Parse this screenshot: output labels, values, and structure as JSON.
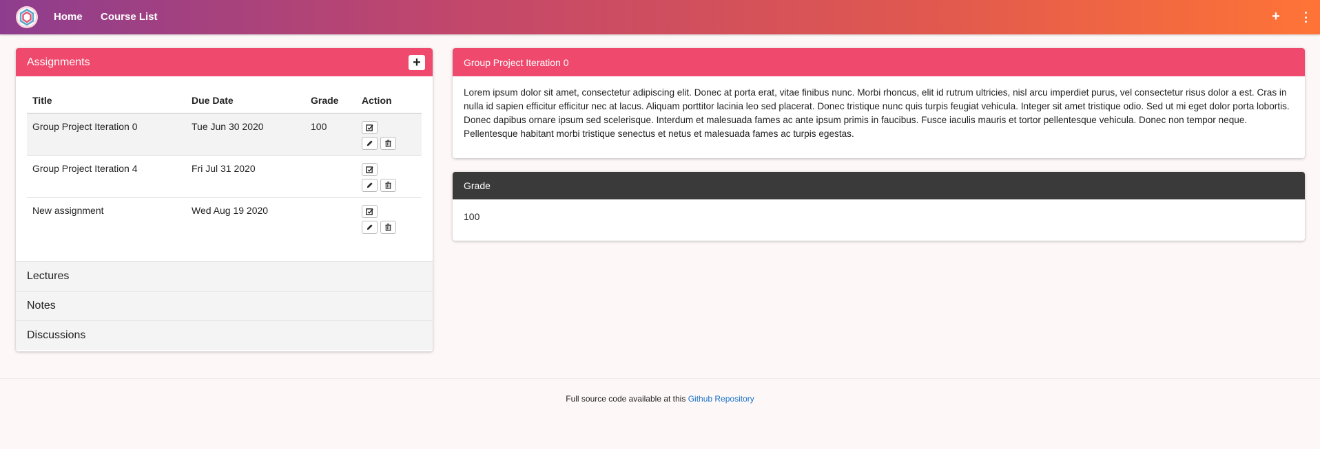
{
  "nav": {
    "home": "Home",
    "course_list": "Course List",
    "plus_icon": "plus-icon",
    "menu_icon": "kebab-menu-icon"
  },
  "assignments": {
    "title": "Assignments",
    "columns": [
      "Title",
      "Due Date",
      "Grade",
      "Action"
    ],
    "rows": [
      {
        "title": "Group Project Iteration 0",
        "due": "Tue Jun 30 2020",
        "grade": "100"
      },
      {
        "title": "Group Project Iteration 4",
        "due": "Fri Jul 31 2020",
        "grade": ""
      },
      {
        "title": "New assignment",
        "due": "Wed Aug 19 2020",
        "grade": ""
      }
    ]
  },
  "sections": [
    "Lectures",
    "Notes",
    "Discussions"
  ],
  "detail": {
    "title": "Group Project Iteration 0",
    "body": "Lorem ipsum dolor sit amet, consectetur adipiscing elit. Donec at porta erat, vitae finibus nunc. Morbi rhoncus, elit id rutrum ultricies, nisl arcu imperdiet purus, vel consectetur risus dolor a est. Cras in nulla id sapien efficitur efficitur nec at lacus. Aliquam porttitor lacinia leo sed placerat. Donec tristique nunc quis turpis feugiat vehicula. Integer sit amet tristique odio. Sed ut mi eget dolor porta lobortis. Donec dapibus ornare ipsum sed scelerisque. Interdum et malesuada fames ac ante ipsum primis in faucibus. Fusce iaculis mauris et tortor pellentesque vehicula. Donec non tempor neque. Pellentesque habitant morbi tristique senectus et netus et malesuada fames ac turpis egestas."
  },
  "grade": {
    "title": "Grade",
    "value": "100"
  },
  "footer": {
    "text": "Full source code available at this ",
    "link": "Github Repository"
  },
  "colors": {
    "accent": "#ef4a6d",
    "dark_header": "#3a3a3a",
    "link": "#1a73c8"
  }
}
